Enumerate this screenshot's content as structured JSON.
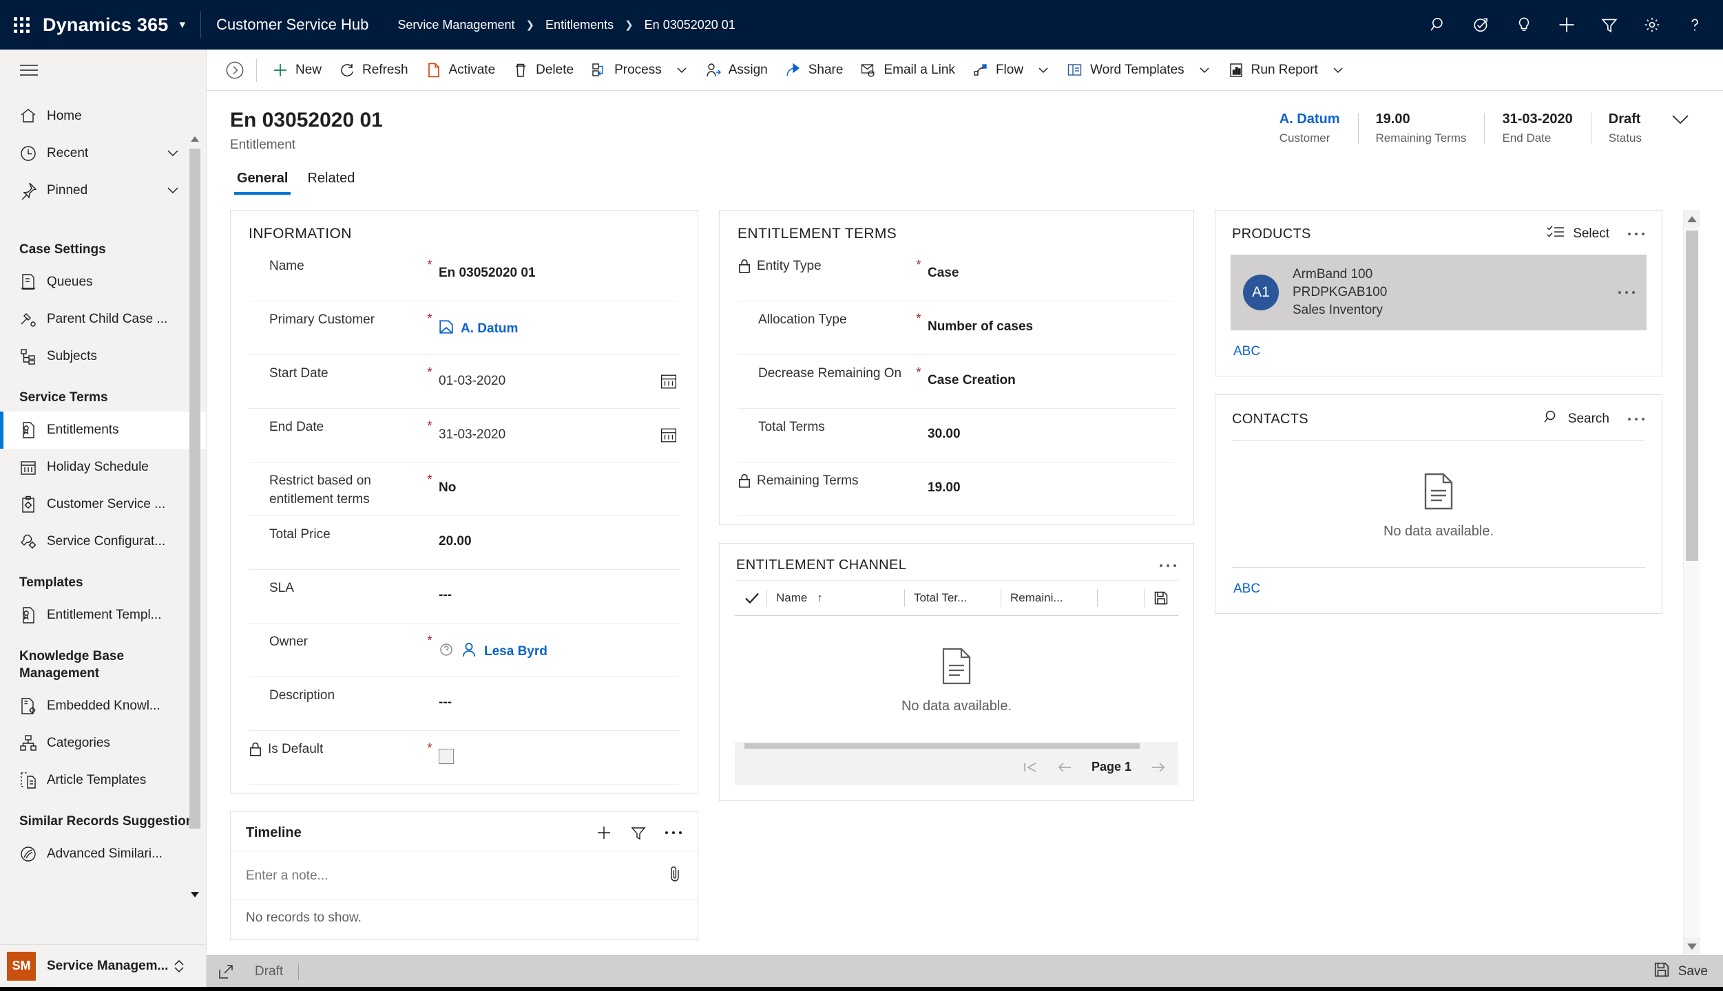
{
  "topbar": {
    "waffle_label": "App launcher",
    "brand": "Dynamics 365",
    "app_name": "Customer Service Hub",
    "breadcrumbs": [
      "Service Management",
      "Entitlements",
      "En 03052020 01"
    ],
    "icons": [
      "search-icon",
      "assistant-icon",
      "insights-lightbulb-icon",
      "quick-create-plus-icon",
      "filter-icon",
      "settings-gear-icon",
      "help-question-icon"
    ],
    "bg_color": "#001B3C"
  },
  "sidebar": {
    "groups": [
      {
        "header": null,
        "items": [
          {
            "label": "Home",
            "icon": "home-icon",
            "caret": false,
            "selected": false
          },
          {
            "label": "Recent",
            "icon": "clock-icon",
            "caret": true,
            "selected": false
          },
          {
            "label": "Pinned",
            "icon": "pin-icon",
            "caret": true,
            "selected": false
          }
        ]
      },
      {
        "header": "Case Settings",
        "items": [
          {
            "label": "Queues",
            "icon": "queue-icon",
            "caret": false,
            "selected": false
          },
          {
            "label": "Parent Child Case ...",
            "icon": "parent-child-case-icon",
            "caret": false,
            "selected": false
          },
          {
            "label": "Subjects",
            "icon": "subjects-icon",
            "caret": false,
            "selected": false
          }
        ]
      },
      {
        "header": "Service Terms",
        "items": [
          {
            "label": "Entitlements",
            "icon": "entitlement-icon",
            "caret": false,
            "selected": true
          },
          {
            "label": "Holiday Schedule",
            "icon": "calendar-icon",
            "caret": false,
            "selected": false
          },
          {
            "label": "Customer Service ...",
            "icon": "clipboard-gear-icon",
            "caret": false,
            "selected": false
          },
          {
            "label": "Service Configurat...",
            "icon": "wrench-gear-icon",
            "caret": false,
            "selected": false
          }
        ]
      },
      {
        "header": "Templates",
        "items": [
          {
            "label": "Entitlement Templ...",
            "icon": "entitlement-icon",
            "caret": false,
            "selected": false
          }
        ]
      },
      {
        "header": "Knowledge Base Management",
        "items": [
          {
            "label": "Embedded Knowl...",
            "icon": "embedded-knowledge-icon",
            "caret": false,
            "selected": false
          },
          {
            "label": "Categories",
            "icon": "categories-hierarchy-icon",
            "caret": false,
            "selected": false
          },
          {
            "label": "Article Templates",
            "icon": "article-template-icon",
            "caret": false,
            "selected": false
          }
        ]
      },
      {
        "header": "Similar Records Suggestion",
        "items": [
          {
            "label": "Advanced Similari...",
            "icon": "advanced-similarity-icon",
            "caret": false,
            "selected": false
          }
        ]
      }
    ],
    "footer": {
      "badge": "SM",
      "label": "Service Managem...",
      "badge_color": "#CA5010"
    }
  },
  "commandbar": {
    "items": [
      {
        "label": "New",
        "icon": "plus-icon",
        "caret": false
      },
      {
        "label": "Refresh",
        "icon": "refresh-icon",
        "caret": false
      },
      {
        "label": "Activate",
        "icon": "activate-page-icon",
        "caret": false
      },
      {
        "label": "Delete",
        "icon": "trash-icon",
        "caret": false
      },
      {
        "label": "Process",
        "icon": "process-icon",
        "caret": true
      },
      {
        "label": "Assign",
        "icon": "assign-person-icon",
        "caret": false
      },
      {
        "label": "Share",
        "icon": "share-icon",
        "caret": false
      },
      {
        "label": "Email a Link",
        "icon": "email-link-icon",
        "caret": false
      },
      {
        "label": "Flow",
        "icon": "flow-icon",
        "caret": true
      },
      {
        "label": "Word Templates",
        "icon": "word-icon",
        "caret": true
      },
      {
        "label": "Run Report",
        "icon": "report-icon",
        "caret": true
      }
    ]
  },
  "record": {
    "title": "En 03052020 01",
    "subtitle": "Entitlement",
    "stats": [
      {
        "value": "A. Datum",
        "label": "Customer",
        "is_link": true
      },
      {
        "value": "19.00",
        "label": "Remaining Terms",
        "is_link": false
      },
      {
        "value": "31-03-2020",
        "label": "End Date",
        "is_link": false
      },
      {
        "value": "Draft",
        "label": "Status",
        "is_link": false
      }
    ],
    "tabs": [
      {
        "label": "General",
        "active": true
      },
      {
        "label": "Related",
        "active": false
      }
    ]
  },
  "information": {
    "title": "INFORMATION",
    "fields": [
      {
        "label": "Name",
        "required": true,
        "value": "En 03052020 01",
        "type": "text",
        "locked": false
      },
      {
        "label": "Primary Customer",
        "required": true,
        "value": "A. Datum",
        "type": "lookup-account",
        "locked": false
      },
      {
        "label": "Start Date",
        "required": true,
        "value": "01-03-2020",
        "type": "date",
        "locked": false
      },
      {
        "label": "End Date",
        "required": true,
        "value": "31-03-2020",
        "type": "date",
        "locked": false
      },
      {
        "label": "Restrict based on entitlement terms",
        "required": true,
        "value": "No",
        "type": "text",
        "locked": false
      },
      {
        "label": "Total Price",
        "required": false,
        "value": "20.00",
        "type": "text",
        "locked": false
      },
      {
        "label": "SLA",
        "required": false,
        "value": "---",
        "type": "text",
        "locked": false
      },
      {
        "label": "Owner",
        "required": true,
        "value": "Lesa Byrd",
        "type": "lookup-user",
        "locked": false
      },
      {
        "label": "Description",
        "required": false,
        "value": "---",
        "type": "text",
        "locked": false
      },
      {
        "label": "Is Default",
        "required": true,
        "value": "",
        "type": "checkbox",
        "locked": true
      }
    ]
  },
  "entitlement_terms": {
    "title": "ENTITLEMENT TERMS",
    "fields": [
      {
        "label": "Entity Type",
        "required": true,
        "value": "Case",
        "type": "text",
        "locked": true
      },
      {
        "label": "Allocation Type",
        "required": true,
        "value": "Number of cases",
        "type": "text",
        "locked": false
      },
      {
        "label": "Decrease Remaining On",
        "required": true,
        "value": "Case Creation",
        "type": "text",
        "locked": false
      },
      {
        "label": "Total Terms",
        "required": false,
        "value": "30.00",
        "type": "text",
        "locked": false
      },
      {
        "label": "Remaining Terms",
        "required": false,
        "value": "19.00",
        "type": "text",
        "locked": true
      }
    ]
  },
  "entitlement_channel": {
    "title": "ENTITLEMENT CHANNEL",
    "columns": [
      "Name",
      "Total Ter...",
      "Remaini..."
    ],
    "sort_indicator": "↑",
    "rows": [],
    "empty_text": "No data available.",
    "page_label": "Page 1"
  },
  "timeline": {
    "title": "Timeline",
    "note_placeholder": "Enter a note...",
    "empty_text": "No records to show.",
    "actions": [
      "add-plus-icon",
      "filter-funnel-icon",
      "more-dots-icon",
      "attach-paperclip-icon"
    ]
  },
  "products": {
    "title": "PRODUCTS",
    "action_label": "Select",
    "action_icon": "select-list-icon",
    "items": [
      {
        "initials": "A1",
        "name": "ArmBand 100",
        "code": "PRDPKGAB100",
        "unit": "Sales Inventory",
        "avatar_color": "#2B579A"
      }
    ],
    "footer_link": "ABC"
  },
  "contacts": {
    "title": "CONTACTS",
    "action_label": "Search",
    "action_icon": "search-icon",
    "empty_text": "No data available.",
    "footer_link": "ABC"
  },
  "statusbar": {
    "state": "Draft",
    "save_label": "Save",
    "expand_icon": "expand-icon",
    "save_icon": "save-disk-icon"
  }
}
